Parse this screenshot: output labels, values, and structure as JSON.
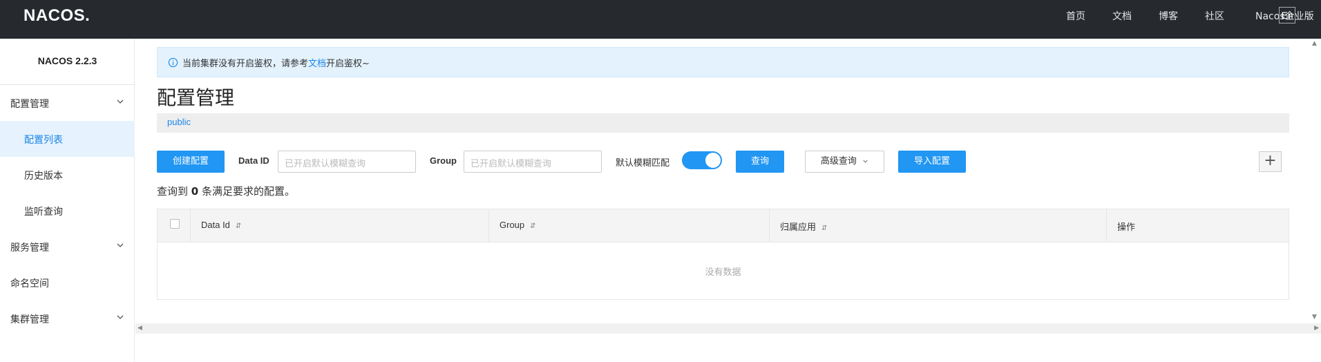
{
  "header": {
    "logo": "NACOS.",
    "nav": [
      "首页",
      "文档",
      "博客",
      "社区",
      "Nacos企业版"
    ],
    "lang": "En"
  },
  "sidebar": {
    "version": "NACOS 2.2.3",
    "items": [
      {
        "label": "配置管理",
        "expandable": true
      },
      {
        "label": "配置列表",
        "active": true
      },
      {
        "label": "历史版本"
      },
      {
        "label": "监听查询"
      },
      {
        "label": "服务管理",
        "expandable": true
      },
      {
        "label": "命名空间"
      },
      {
        "label": "集群管理",
        "expandable": true
      }
    ]
  },
  "notice": {
    "prefix": "当前集群没有开启鉴权，请参考",
    "link": "文档",
    "suffix": "开启鉴权~"
  },
  "page": {
    "title": "配置管理",
    "namespace": "public"
  },
  "toolbar": {
    "create_label": "创建配置",
    "dataid_label": "Data ID",
    "dataid_placeholder": "已开启默认模糊查询",
    "group_label": "Group",
    "group_placeholder": "已开启默认模糊查询",
    "fuzzy_label": "默认模糊匹配",
    "fuzzy_on": true,
    "search_label": "查询",
    "advanced_label": "高级查询",
    "import_label": "导入配置",
    "plus": "+"
  },
  "result": {
    "prefix": "查询到",
    "count": "0",
    "suffix": "条满足要求的配置。"
  },
  "table": {
    "columns": [
      "Data Id",
      "Group",
      "归属应用",
      "操作"
    ],
    "empty": "没有数据"
  },
  "colors": {
    "topbar": "#262a2f",
    "primary": "#2196f3",
    "link": "#1a86e8"
  }
}
